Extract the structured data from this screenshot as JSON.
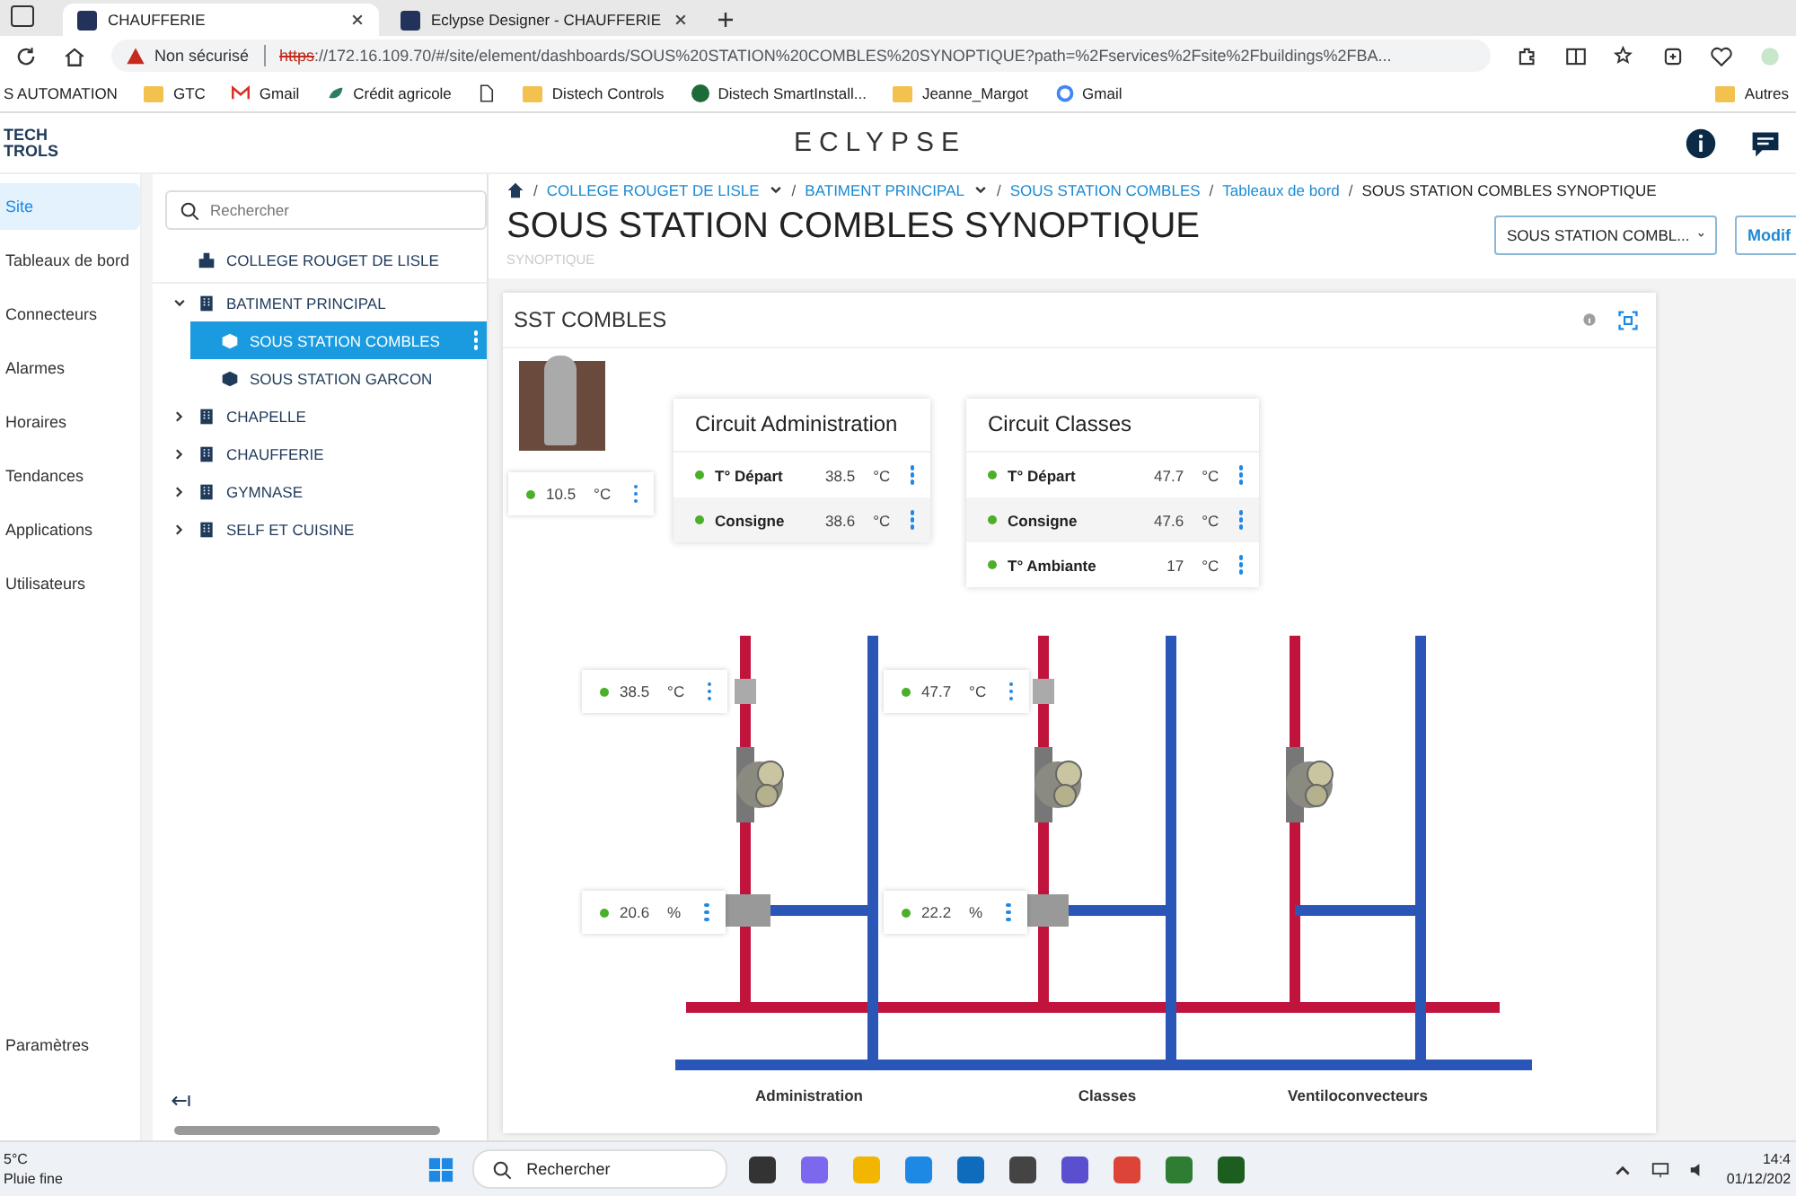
{
  "browser": {
    "tabs": [
      {
        "title": "CHAUFFERIE",
        "selected": true
      },
      {
        "title": "Eclypse Designer - CHAUFFERIE",
        "selected": false
      }
    ],
    "security": "Non sécurisé",
    "url_scheme": "https",
    "url_rest": "://172.16.109.70/#/site/element/dashboards/SOUS%20STATION%20COMBLES%20SYNOPTIQUE?path=%2Fservices%2Fsite%2Fbuildings%2FBA...",
    "bookmarks": [
      {
        "label": "S AUTOMATION",
        "kind": "plain"
      },
      {
        "label": "GTC",
        "kind": "folder"
      },
      {
        "label": "Gmail",
        "kind": "mail"
      },
      {
        "label": "Crédit agricole",
        "kind": "bank"
      },
      {
        "kind": "page"
      },
      {
        "label": "Distech Controls",
        "kind": "folder"
      },
      {
        "label": "Distech SmartInstall...",
        "kind": "round"
      },
      {
        "label": "Jeanne_Margot",
        "kind": "folder"
      },
      {
        "label": "Gmail",
        "kind": "google"
      }
    ],
    "other_bookmarks": "Autres"
  },
  "app": {
    "logo_lines": [
      "TECH",
      "TROLS"
    ],
    "brand": "ECLYPSE"
  },
  "nav": [
    {
      "label": "Site",
      "selected": true
    },
    {
      "label": "Tableaux de bord",
      "selected": false
    },
    {
      "label": "Connecteurs",
      "selected": false
    },
    {
      "label": "Alarmes",
      "selected": false
    },
    {
      "label": "Horaires",
      "selected": false
    },
    {
      "label": "Tendances",
      "selected": false
    },
    {
      "label": "Applications",
      "selected": false
    },
    {
      "label": "Utilisateurs",
      "selected": false
    }
  ],
  "nav_bottom": "Paramètres",
  "tree": {
    "placeholder": "Rechercher",
    "root": "COLLEGE ROUGET DE LISLE",
    "items": [
      {
        "label": "BATIMENT PRINCIPAL",
        "expanded": true,
        "children": [
          {
            "label": "SOUS STATION COMBLES",
            "selected": true
          },
          {
            "label": "SOUS STATION GARCON",
            "selected": false
          }
        ]
      },
      {
        "label": "CHAPELLE",
        "expanded": false
      },
      {
        "label": "CHAUFFERIE",
        "expanded": false
      },
      {
        "label": "GYMNASE",
        "expanded": false
      },
      {
        "label": "SELF ET CUISINE",
        "expanded": false
      }
    ]
  },
  "breadcrumb": [
    {
      "separator": "/",
      "label": "COLLEGE ROUGET DE LISLE",
      "dropdown": true,
      "current": false
    },
    {
      "separator": "/",
      "label": "BATIMENT PRINCIPAL",
      "dropdown": true,
      "current": false
    },
    {
      "separator": "/",
      "label": "SOUS STATION COMBLES",
      "dropdown": false,
      "current": false
    },
    {
      "separator": "/",
      "label": "Tableaux de bord",
      "dropdown": false,
      "current": false
    },
    {
      "separator": "/",
      "label": "SOUS STATION COMBLES SYNOPTIQUE",
      "dropdown": false,
      "current": true
    }
  ],
  "page_title": "SOUS STATION COMBLES SYNOPTIQUE",
  "page_subtitle": "SYNOPTIQUE",
  "dashboard_select": "SOUS STATION COMBL...",
  "edit_button": "Modif",
  "panel": {
    "title": "SST COMBLES",
    "outdoor": {
      "value": "10.5",
      "unit": "°C"
    },
    "circuits": [
      {
        "title": "Circuit Administration",
        "rows": [
          {
            "label": "T° Départ",
            "value": "38.5",
            "unit": "°C"
          },
          {
            "label": "Consigne",
            "value": "38.6",
            "unit": "°C"
          }
        ]
      },
      {
        "title": "Circuit Classes",
        "rows": [
          {
            "label": "T° Départ",
            "value": "47.7",
            "unit": "°C"
          },
          {
            "label": "Consigne",
            "value": "47.6",
            "unit": "°C"
          },
          {
            "label": "T° Ambiante",
            "value": "17",
            "unit": "°C"
          }
        ]
      }
    ],
    "loops": [
      {
        "label": "Administration",
        "supply": {
          "value": "38.5",
          "unit": "°C"
        },
        "valve": {
          "value": "20.6",
          "unit": "%"
        }
      },
      {
        "label": "Classes",
        "supply": {
          "value": "47.7",
          "unit": "°C"
        },
        "valve": {
          "value": "22.2",
          "unit": "%"
        }
      },
      {
        "label": "Ventiloconvecteurs"
      }
    ]
  },
  "taskbar": {
    "weather_temp": "5°C",
    "weather_text": "Pluie fine",
    "search": "Rechercher",
    "time": "14:4",
    "date": "01/12/202"
  }
}
